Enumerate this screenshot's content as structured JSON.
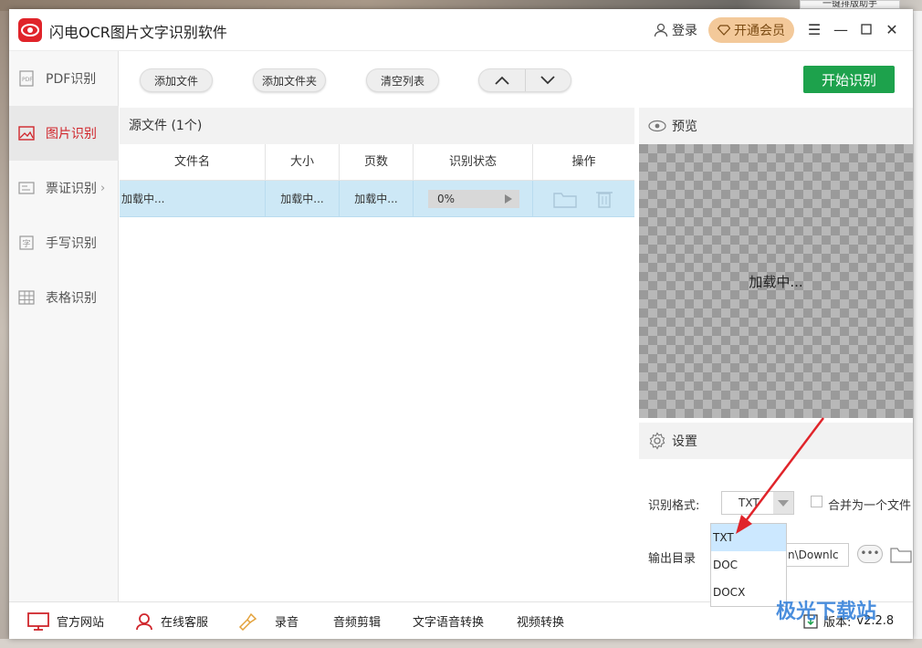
{
  "desktop": {
    "peek_tab": "一键排版助手"
  },
  "app": {
    "title": "闪电OCR图片文字识别软件",
    "login": "登录",
    "vip": "开通会员"
  },
  "sidebar": {
    "items": [
      {
        "label": "PDF识别",
        "icon": "pdf-icon"
      },
      {
        "label": "图片识别",
        "icon": "image-icon",
        "active": true
      },
      {
        "label": "票证识别",
        "icon": "ticket-icon"
      },
      {
        "label": "手写识别",
        "icon": "handwriting-icon"
      },
      {
        "label": "表格识别",
        "icon": "table-icon"
      }
    ]
  },
  "toolbar": {
    "add_file": "添加文件",
    "add_folder": "添加文件夹",
    "clear_list": "清空列表",
    "start": "开始识别"
  },
  "files": {
    "header": "源文件 (1个)",
    "columns": [
      "文件名",
      "大小",
      "页数",
      "识别状态",
      "操作"
    ],
    "rows": [
      {
        "name": "加载中...",
        "size": "加载中...",
        "pages": "加载中...",
        "progress": "0%"
      }
    ]
  },
  "preview": {
    "title": "预览",
    "loading": "加载中..."
  },
  "settings": {
    "title": "设置",
    "format_label": "识别格式:",
    "format_value": "TXT",
    "format_options": [
      "TXT",
      "DOC",
      "DOCX"
    ],
    "merge_label": "合并为一个文件",
    "output_label": "输出目录",
    "output_value": "n\\Downlc",
    "dots": "•••"
  },
  "bottom": {
    "items": [
      "官方网站",
      "在线客服",
      "录音",
      "音频剪辑",
      "文字语音转换",
      "视频转换"
    ],
    "version_label": "版本:",
    "version_value": "v2.2.8"
  },
  "watermark": {
    "text": "极光下载站"
  },
  "colors": {
    "brand_red": "#e0242a",
    "start_green": "#1da24c",
    "selected_row": "#cde8f6",
    "vip_gold": "#f3c99a"
  }
}
